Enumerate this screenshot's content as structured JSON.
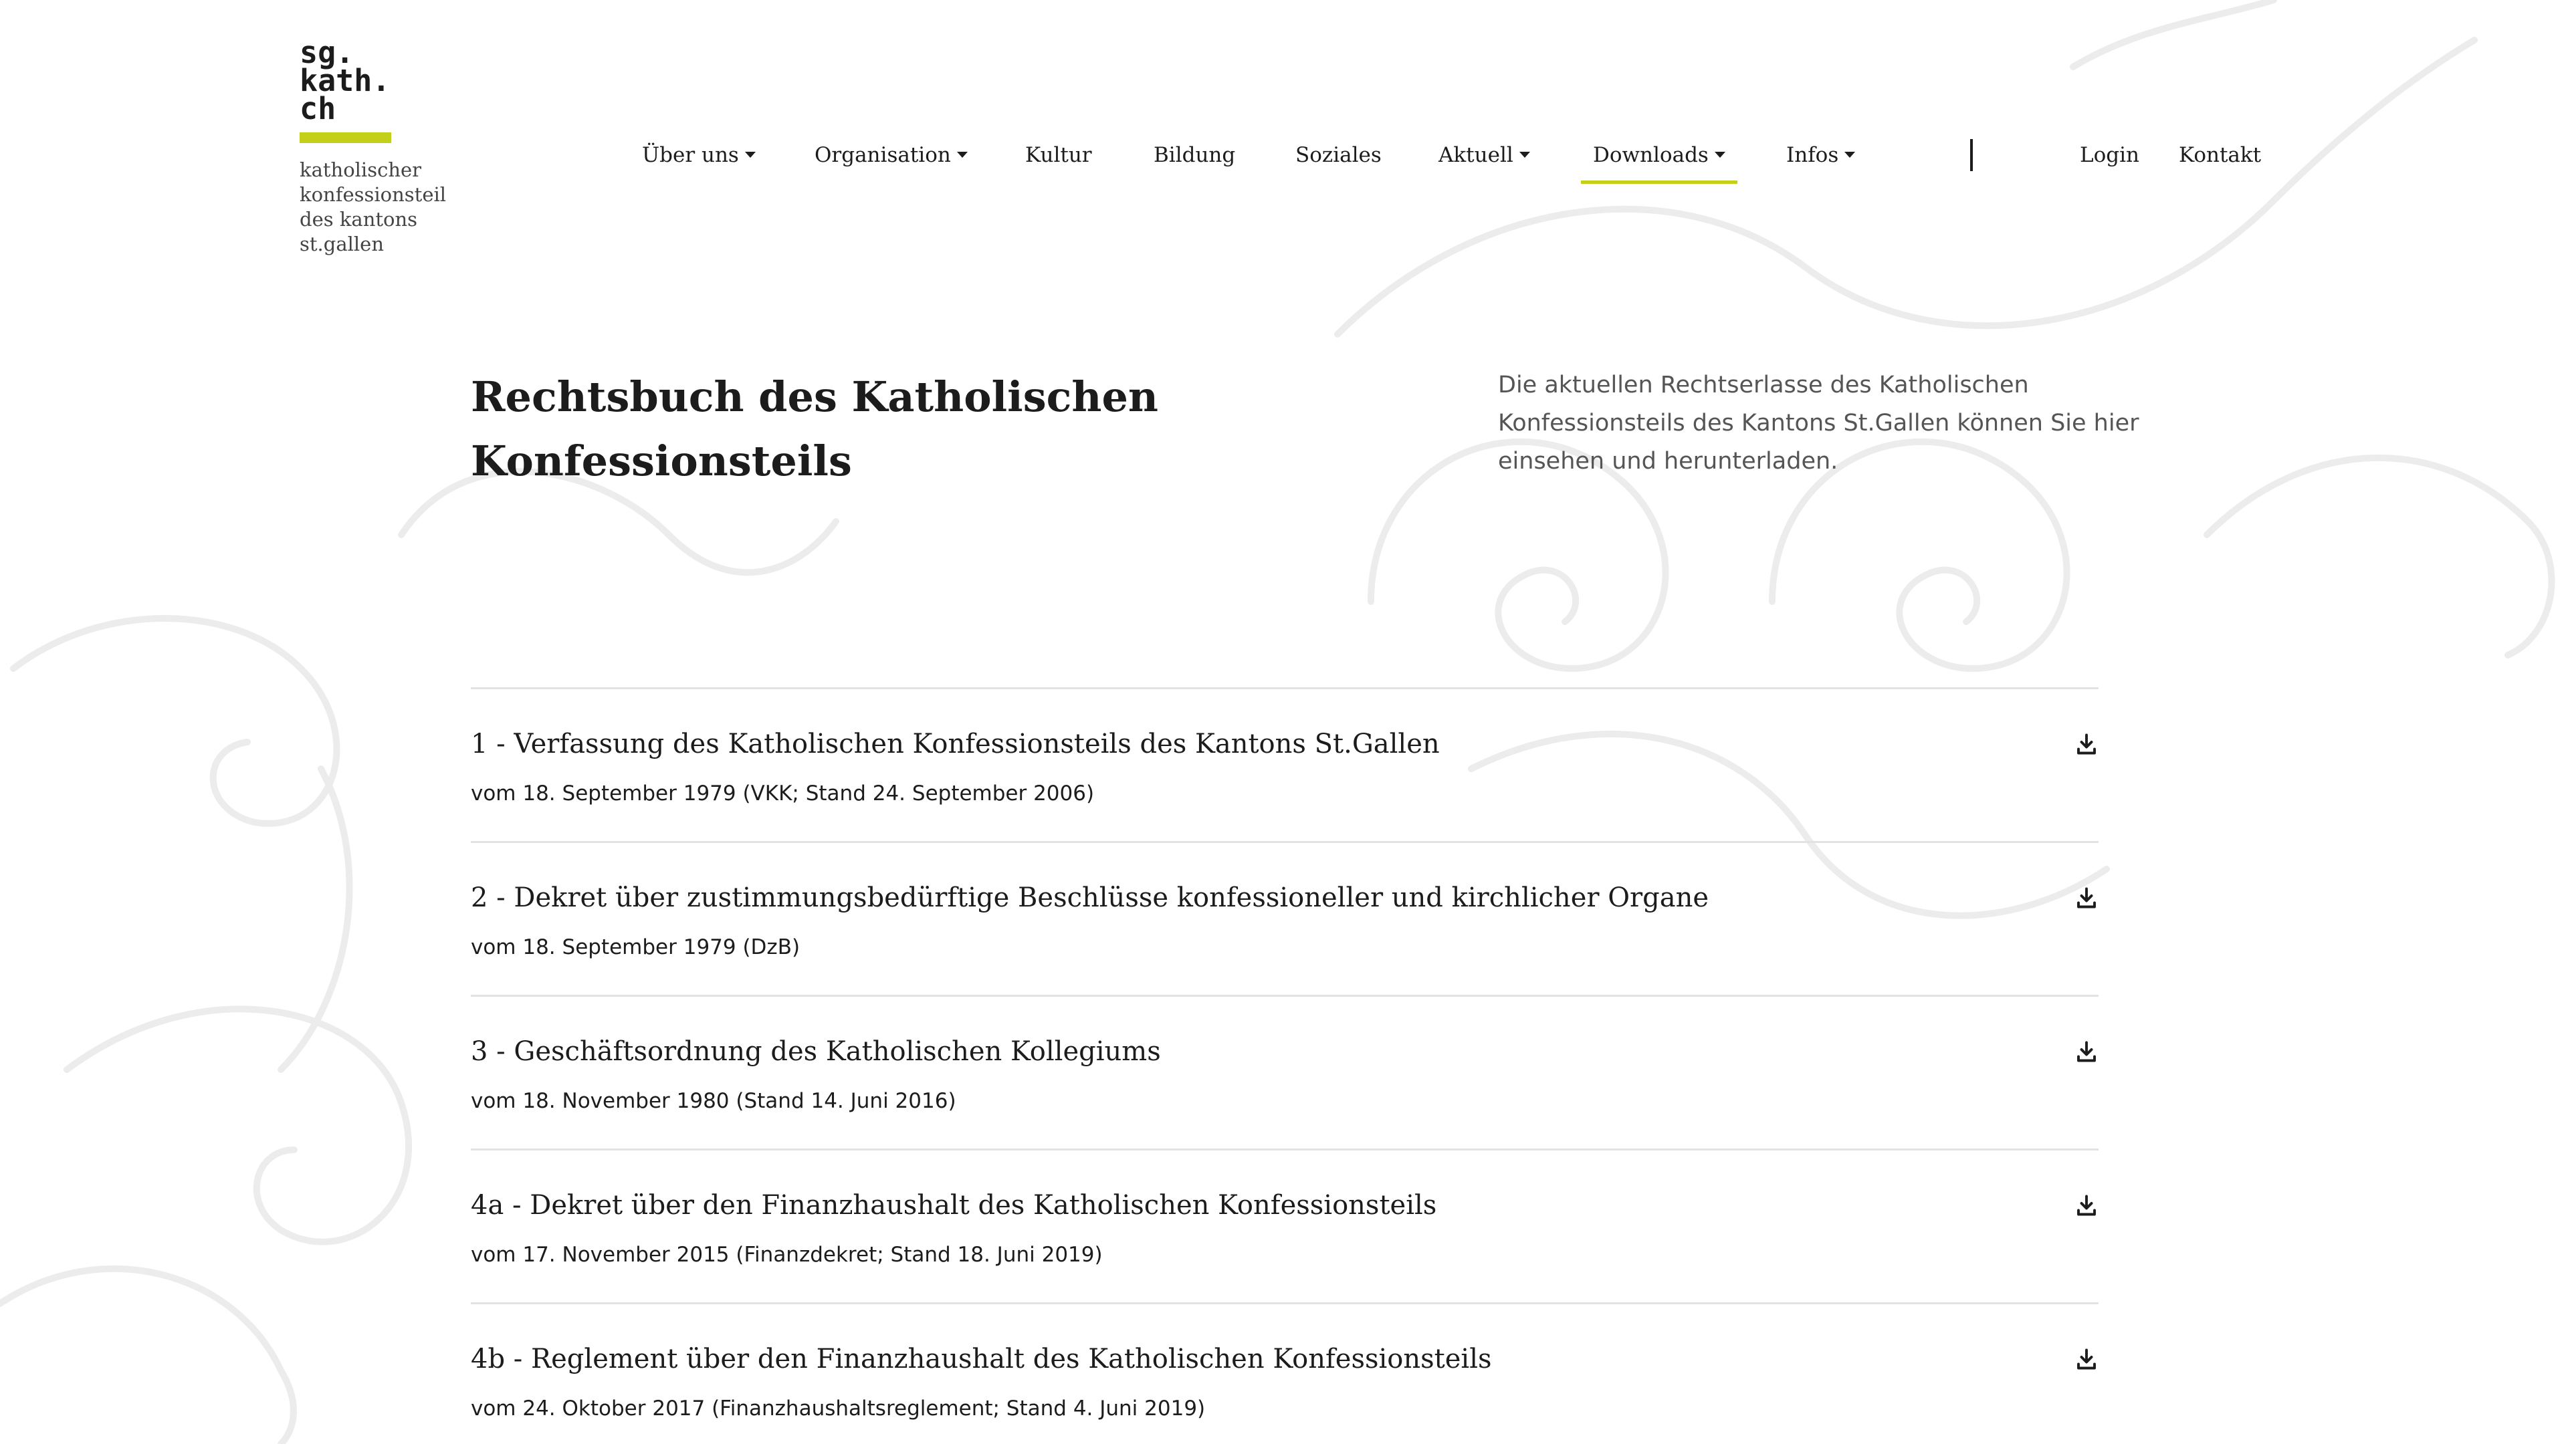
{
  "logo": {
    "wordmark": "sg.\nkath.\nch",
    "tagline": "katholischer\nkonfessionsteil\ndes kantons\nst.gallen",
    "accent_color": "#c4cf1a"
  },
  "nav": {
    "items": [
      {
        "label": "Über uns",
        "dropdown": true
      },
      {
        "label": "Organisation",
        "dropdown": true
      },
      {
        "label": "Kultur",
        "dropdown": false
      },
      {
        "label": "Bildung",
        "dropdown": false
      },
      {
        "label": "Soziales",
        "dropdown": false
      },
      {
        "label": "Aktuell",
        "dropdown": true
      },
      {
        "label": "Downloads",
        "dropdown": true,
        "active": true
      },
      {
        "label": "Infos",
        "dropdown": true
      }
    ],
    "login": "Login",
    "kontakt": "Kontakt"
  },
  "page": {
    "title": "Rechtsbuch des Katholischen Konfessionsteils",
    "intro": "Die aktuellen Rechtserlasse des Katholischen Konfessionsteils des Kantons St.Gallen können Sie hier einsehen und herunterladen."
  },
  "documents": [
    {
      "title": "1 - Verfassung des Katholischen Konfessionsteils des Kantons St.Gallen",
      "subtitle": "vom 18. September 1979 (VKK; Stand 24. September 2006)",
      "icon": "download-icon"
    },
    {
      "title": "2 - Dekret über zustimmungsbedürftige Beschlüsse konfessioneller und kirchlicher Organe",
      "subtitle": "vom 18. September 1979 (DzB)",
      "icon": "download-icon"
    },
    {
      "title": "3 - Geschäftsordnung des Katholischen Kollegiums",
      "subtitle": "vom 18. November 1980 (Stand 14. Juni 2016)",
      "icon": "download-icon"
    },
    {
      "title": "4a - Dekret über den Finanzhaushalt des Katholischen Konfessionsteils",
      "subtitle": "vom 17. November 2015 (Finanzdekret; Stand 18. Juni 2019)",
      "icon": "download-icon"
    },
    {
      "title": "4b - Reglement über den Finanzhaushalt des Katholischen Konfessionsteils",
      "subtitle": "vom 24. Oktober 2017 (Finanzhaushaltsreglement; Stand 4. Juni 2019)",
      "icon": "download-icon"
    }
  ]
}
